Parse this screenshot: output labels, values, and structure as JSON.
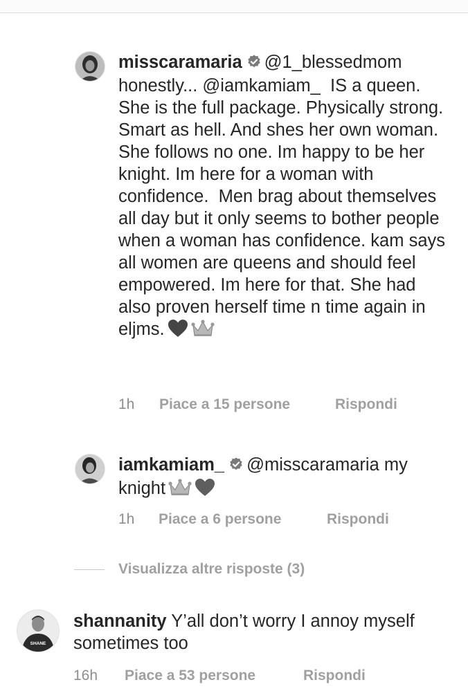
{
  "comments": [
    {
      "username": "misscaramaria",
      "text": "@1_blessedmom honestly... @iamkamiam_  IS a queen. She is the full package. Physically strong. Smart as hell. And shes her own woman. She follows no one. Im happy to be her knight. Im here for a woman with confidence.  Men brag about themselves all day but it only seems to bother people when a woman has confidence. kam says all women are queens and should feel empowered. Im here for that. She had also proven herself time n time again in eljms.",
      "emojis": [
        "heart-icon",
        "crown-icon"
      ],
      "time": "1h",
      "likes": "Piace a 15 persone",
      "reply": "Rispondi"
    },
    {
      "username": "iamkamiam_",
      "text": "@misscaramaria my knight",
      "emojis": [
        "crown-icon",
        "heart-icon"
      ],
      "time": "1h",
      "likes": "Piace a 6 persone",
      "reply": "Rispondi"
    },
    {
      "username": "shannanity",
      "text": "Y’all don’t worry I annoy myself sometimes too",
      "time": "16h",
      "likes": "Piace a 53 persone",
      "reply": "Rispondi"
    }
  ],
  "view_more": "Visualizza altre risposte (3)",
  "avatar_shirt_text": "SHANE",
  "colors": {
    "text": "#262626",
    "meta": "#8e8e8e",
    "divider": "#c7c7c7"
  }
}
